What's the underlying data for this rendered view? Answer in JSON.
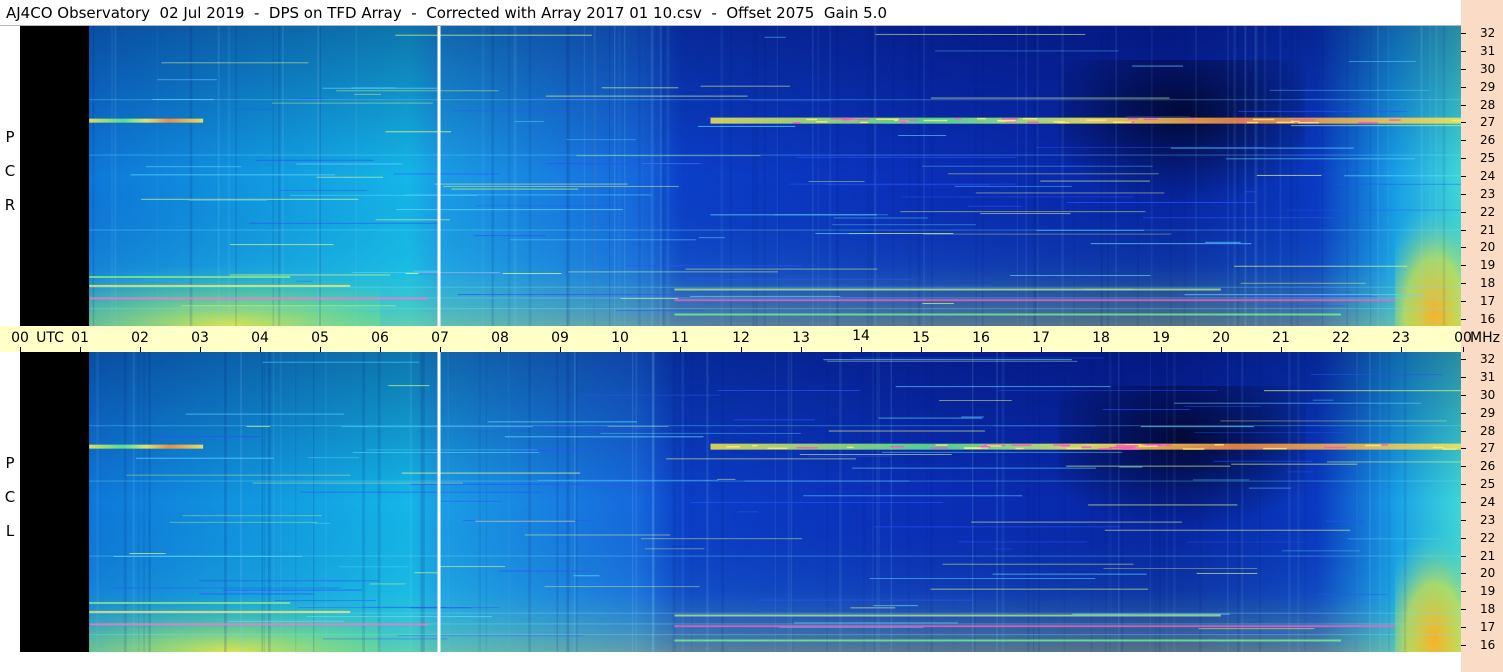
{
  "title": "AJ4CO Observatory  02 Jul 2019  -  DPS on TFD Array  -  Corrected with Array 2017 01 10.csv  -  Offset 2075  Gain 5.0",
  "chart_data": {
    "type": "heatmap",
    "title": "AJ4CO Observatory  02 Jul 2019  -  DPS on TFD Array  -  Corrected with Array 2017 01 10.csv  -  Offset 2075  Gain 5.0",
    "x_axis": {
      "unit_label": "UTC",
      "range_hours": [
        0,
        24
      ],
      "ticks": [
        "00",
        "01",
        "02",
        "03",
        "04",
        "05",
        "06",
        "07",
        "08",
        "09",
        "10",
        "11",
        "12",
        "13",
        "14",
        "15",
        "16",
        "17",
        "18",
        "19",
        "20",
        "21",
        "22",
        "23",
        "00"
      ]
    },
    "y_axis": {
      "unit_label": "MHz",
      "range_mhz": [
        16,
        32
      ],
      "ticks": [
        "32",
        "31",
        "30",
        "29",
        "28",
        "27",
        "26",
        "25",
        "24",
        "23",
        "22",
        "21",
        "20",
        "19",
        "18",
        "17",
        "16"
      ]
    },
    "panels": [
      {
        "label": "R C P",
        "label_letters": [
          "R",
          "C",
          "P"
        ]
      },
      {
        "label": "L C P",
        "label_letters": [
          "L",
          "C",
          "P"
        ]
      }
    ],
    "features": {
      "no_data_until_hour": 1.15,
      "data_gap_hour": 6.97,
      "strong_band_mhz": 27.1
    },
    "colors": {
      "title_bg": "#ffffff",
      "time_axis_bg": "#ffffc8",
      "freq_axis_bg": "#fadcc6",
      "no_data": "#000000"
    }
  }
}
